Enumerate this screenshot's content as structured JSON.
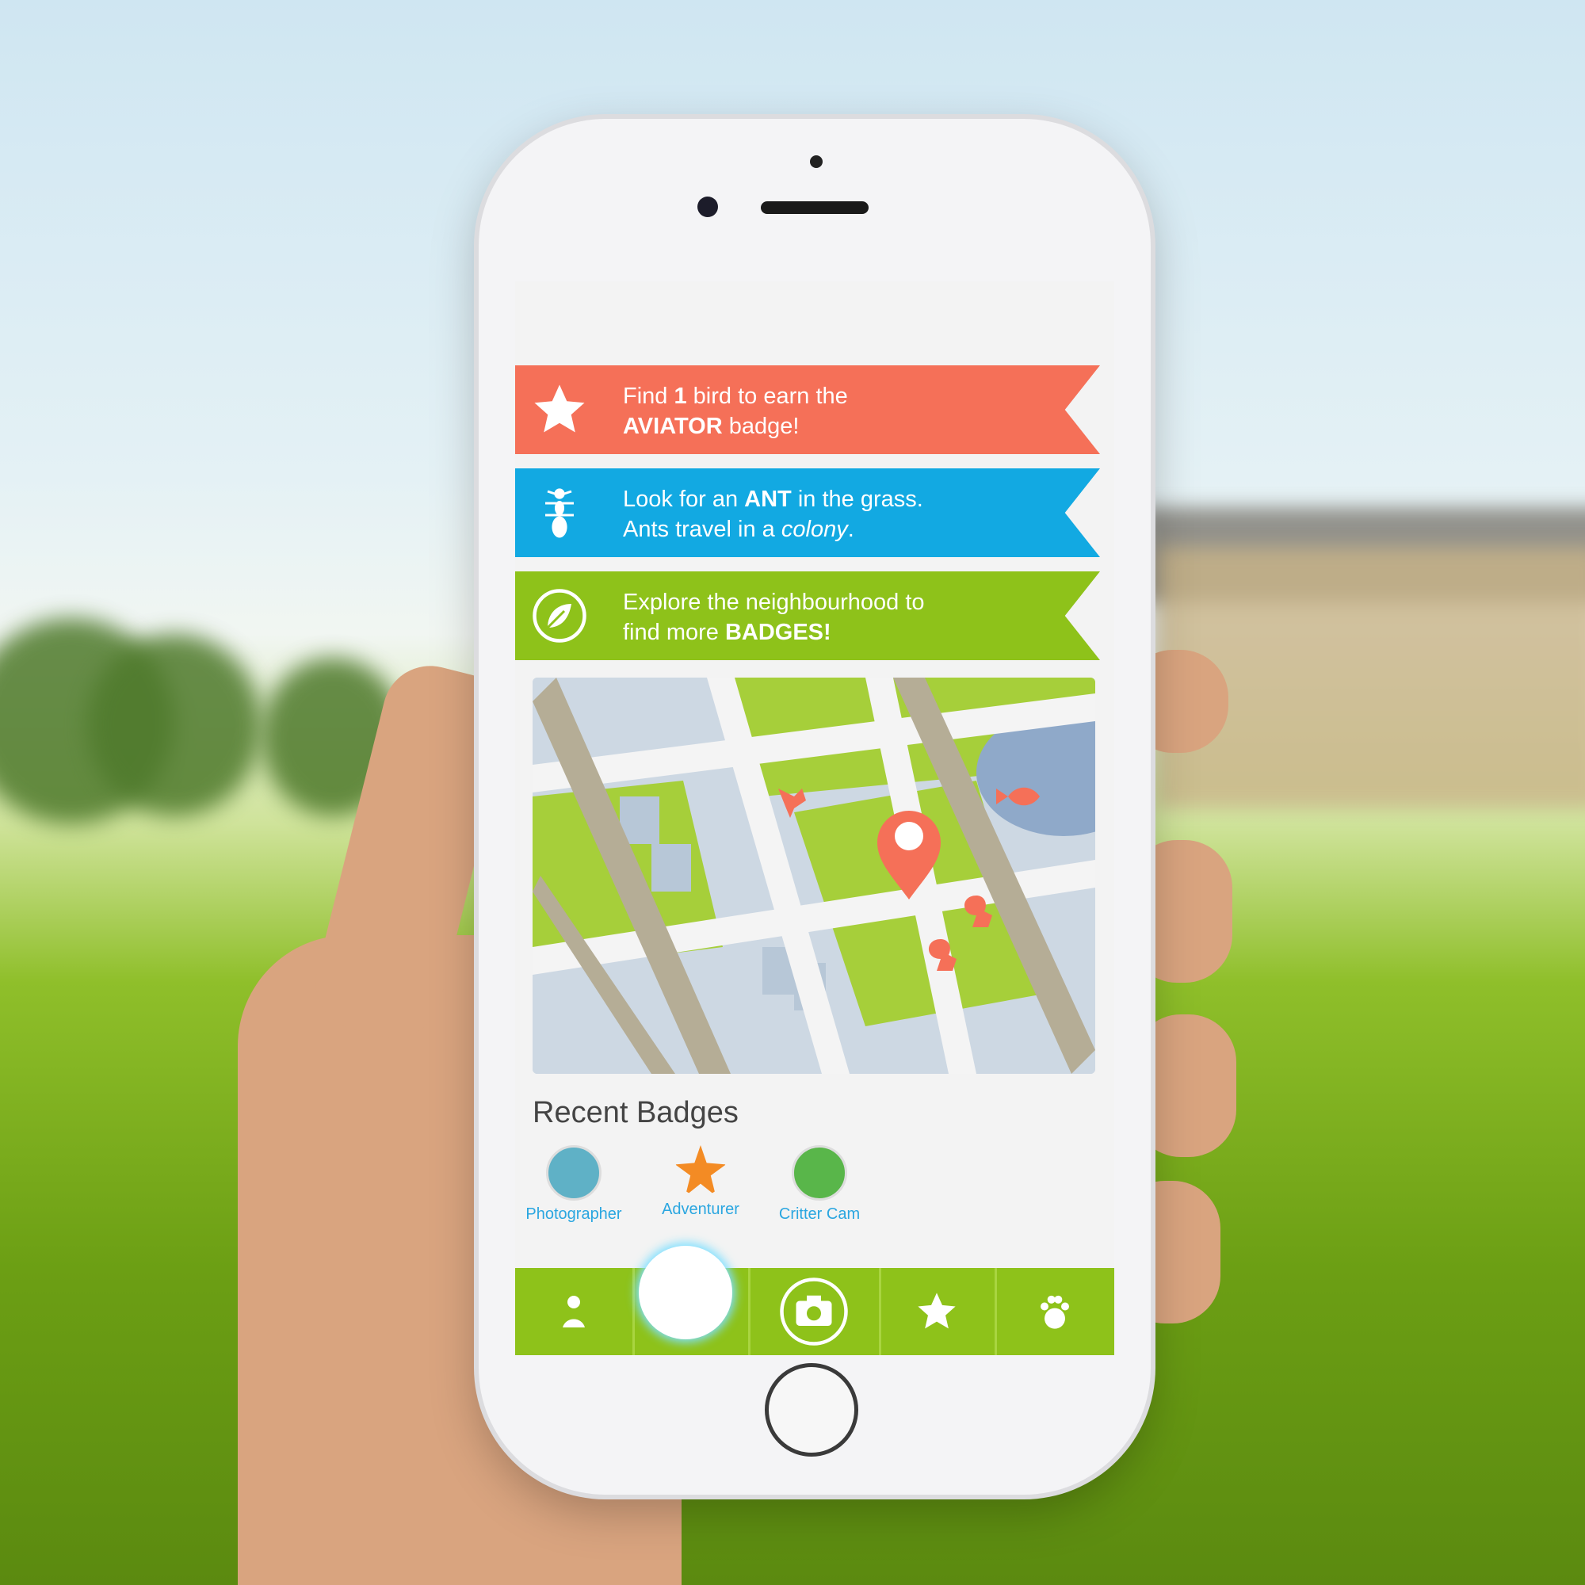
{
  "banners": [
    {
      "line1_pre": "Find ",
      "line1_bold": "1",
      "line1_post": " bird to earn the",
      "line2_bold": "AVIATOR",
      "line2_post": " badge!",
      "color": "#f57058",
      "icon": "star-icon"
    },
    {
      "line1_pre": "Look for an ",
      "line1_bold": "ANT",
      "line1_post": " in the grass.",
      "line2_pre": "Ants travel in a ",
      "line2_italic": "colony",
      "line2_post": ".",
      "color": "#12a9e2",
      "icon": "ant-icon"
    },
    {
      "line1": "Explore the neighbourhood to",
      "line2_pre": "find more ",
      "line2_bold": "BADGES!",
      "color": "#8ec21a",
      "icon": "leaf-icon"
    }
  ],
  "recent_badges": {
    "title": "Recent Badges",
    "items": [
      {
        "label": "Photographer",
        "icon": "camera-badge-icon",
        "color": "#5fb1c6"
      },
      {
        "label": "Adventurer",
        "icon": "star-badge-icon",
        "color": "#f38b24"
      },
      {
        "label": "Critter Cam",
        "icon": "thermometer-badge-icon",
        "color": "#59b64a"
      }
    ]
  },
  "nav": [
    "profile-icon",
    "map-icon",
    "camera-icon",
    "star-icon",
    "paw-icon"
  ],
  "map": {
    "pins": [
      "bird-icon",
      "fish-icon",
      "squirrel-icon",
      "squirrel-icon",
      "location-pin-icon"
    ]
  }
}
